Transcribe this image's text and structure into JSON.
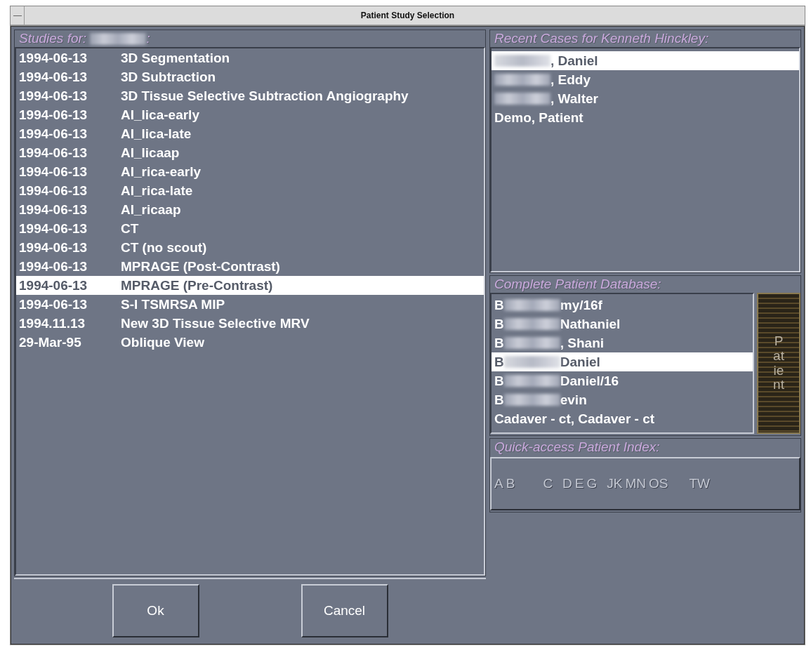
{
  "window": {
    "title": "Patient Study Selection"
  },
  "studies": {
    "title": "Studies for:",
    "redacted": true,
    "suffix": ":",
    "rows": [
      {
        "date": "1994-06-13",
        "name": "3D Segmentation",
        "selected": false
      },
      {
        "date": "1994-06-13",
        "name": "3D Subtraction",
        "selected": false
      },
      {
        "date": "1994-06-13",
        "name": "3D Tissue Selective Subtraction Angiography",
        "selected": false
      },
      {
        "date": "1994-06-13",
        "name": "AI_lica-early",
        "selected": false
      },
      {
        "date": "1994-06-13",
        "name": "AI_lica-late",
        "selected": false
      },
      {
        "date": "1994-06-13",
        "name": "AI_licaap",
        "selected": false
      },
      {
        "date": "1994-06-13",
        "name": "AI_rica-early",
        "selected": false
      },
      {
        "date": "1994-06-13",
        "name": "AI_rica-late",
        "selected": false
      },
      {
        "date": "1994-06-13",
        "name": "AI_ricaap",
        "selected": false
      },
      {
        "date": "1994-06-13",
        "name": "CT",
        "selected": false
      },
      {
        "date": "1994-06-13",
        "name": "CT (no scout)",
        "selected": false
      },
      {
        "date": "1994-06-13",
        "name": "MPRAGE (Post-Contrast)",
        "selected": false
      },
      {
        "date": "1994-06-13",
        "name": "MPRAGE (Pre-Contrast)",
        "selected": true
      },
      {
        "date": "1994-06-13",
        "name": "S-I TSMRSA MIP",
        "selected": false
      },
      {
        "date": "1994.11.13",
        "name": "New 3D Tissue Selective MRV",
        "selected": false
      },
      {
        "date": "29-Mar-95",
        "name": "Oblique View",
        "selected": false
      }
    ]
  },
  "buttons": [
    "Ok",
    "Cancel"
  ],
  "recent_cases": {
    "title": "Recent Cases for Kenneth Hinckley:",
    "items": [
      {
        "redacted": true,
        "after": ", Daniel",
        "selected": true
      },
      {
        "redacted": true,
        "after": ", Eddy",
        "selected": false
      },
      {
        "redacted": true,
        "after": ", Walter",
        "selected": false
      },
      {
        "redacted": false,
        "text": "Demo, Patient",
        "selected": false
      }
    ]
  },
  "patient_database": {
    "title": "Complete Patient Database:",
    "side_button": "Patient",
    "items": [
      {
        "redacted": true,
        "before": "B",
        "after": "my/16f",
        "selected": false
      },
      {
        "redacted": true,
        "before": "B",
        "after": "Nathaniel",
        "selected": false
      },
      {
        "redacted": true,
        "before": "B",
        "after": ", Shani",
        "selected": false
      },
      {
        "redacted": true,
        "before": "B",
        "after": "Daniel",
        "selected": true
      },
      {
        "redacted": true,
        "before": "B",
        "after": "Daniel/16",
        "selected": false
      },
      {
        "redacted": true,
        "before": "B",
        "after": "evin",
        "selected": false
      },
      {
        "redacted": false,
        "text": "Cadaver - ct, Cadaver - ct",
        "selected": false
      }
    ]
  },
  "quick_index": {
    "title": "Quick-access Patient Index:",
    "letters": [
      "A",
      "B",
      "C",
      "D",
      "E",
      "G",
      "JK",
      "MN",
      "OS",
      "TW"
    ]
  }
}
